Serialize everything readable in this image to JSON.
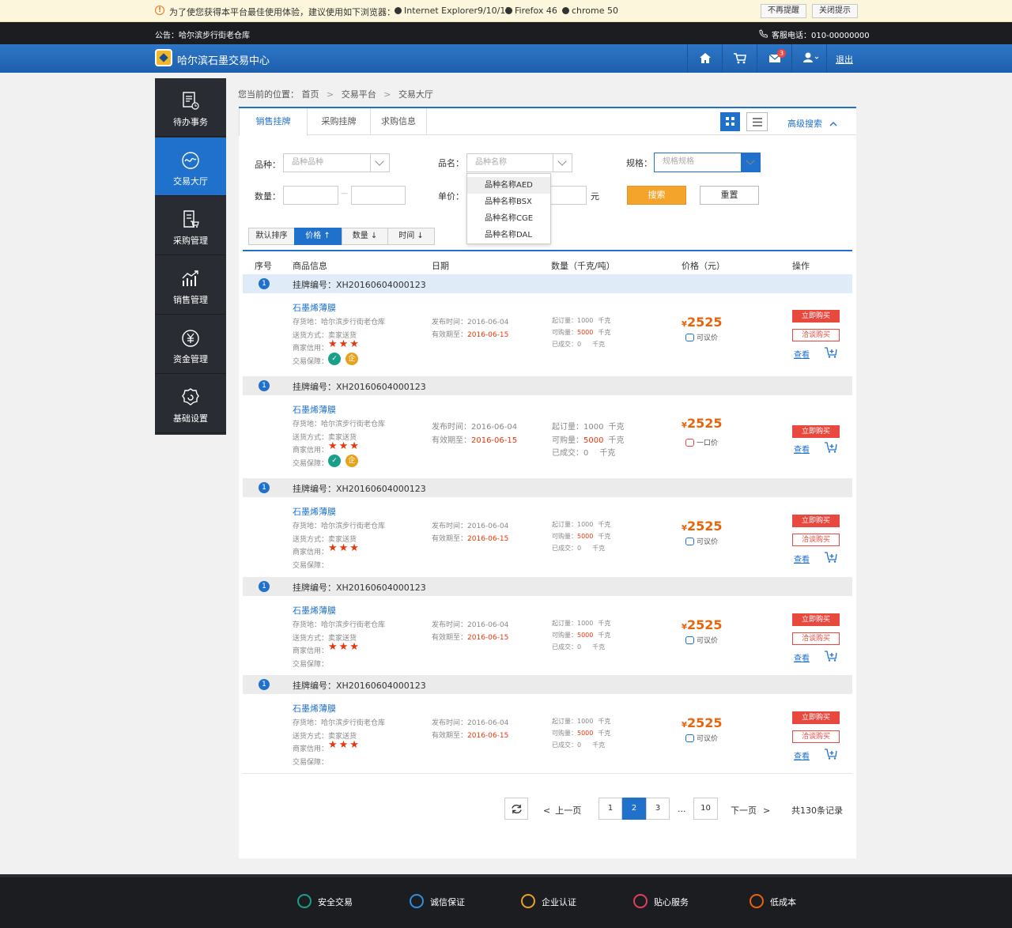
{
  "tip": {
    "message": "为了使您获得本平台最佳使用体验，建议使用如下浏览器：",
    "browsers": [
      "Internet Explorer9/10/11",
      "Firefox 46",
      "chrome 50"
    ],
    "btn_no_remind": "不再提醒",
    "btn_close": "关闭提示"
  },
  "notice": {
    "text": "公告：哈尔滨步行街老仓库",
    "hotline": "客服电话：010-00000000"
  },
  "header": {
    "site_name": "哈尔滨石墨交易中心",
    "mail_count": "3",
    "logout": "退出"
  },
  "sidebar": {
    "items": [
      {
        "label": "待办事务",
        "icon": "todo-icon"
      },
      {
        "label": "交易大厅",
        "icon": "trade-hall-icon",
        "active": true
      },
      {
        "label": "采购管理",
        "icon": "purchase-icon"
      },
      {
        "label": "销售管理",
        "icon": "sales-chart-icon"
      },
      {
        "label": "资金管理",
        "icon": "yuan-icon"
      },
      {
        "label": "基础设置",
        "icon": "gear-icon"
      }
    ]
  },
  "breadcrumb": {
    "prefix": "您当前的位置：",
    "items": [
      "首页",
      "交易平台",
      "交易大厅"
    ]
  },
  "tabs": [
    "销售挂牌",
    "采购挂牌",
    "求购信息"
  ],
  "advanced_search": "高级搜索",
  "filters": {
    "variety_label": "品种：",
    "variety_placeholder": "品种品种",
    "name_label": "品名：",
    "name_placeholder": "品种名称",
    "spec_label": "规格：",
    "spec_placeholder": "规格规格",
    "qty_label": "数量：",
    "qty_sep": "—",
    "price_label": "单价：",
    "price_unit": "元",
    "search": "搜索",
    "reset": "重置",
    "name_options": [
      "品种名称AED",
      "品种名称BSX",
      "品种名称CGE",
      "品种名称DAL"
    ]
  },
  "sort": {
    "items": [
      "默认排序",
      "价格",
      "数量",
      "时间"
    ],
    "active": "价格"
  },
  "table_headers": [
    "序号",
    "商品信息",
    "日期",
    "数量（千克/吨）",
    "价格（元）",
    "操作"
  ],
  "listings": [
    {
      "no": "1",
      "code": "挂牌编号：XH20160604000123",
      "name": "石墨烯薄膜",
      "warehouse": "存货地：哈尔滨步行街老仓库",
      "delivery": "送货方式：卖家送货",
      "credit": "商家信用：",
      "guarantee": "交易保障：",
      "publish": "发布时间：2016-06-04",
      "valid_label": "有效期至：",
      "valid": "2016-06-15",
      "min_label": "起订量：",
      "min": "1000",
      "avail_label": "可购量：",
      "avail": "5000",
      "done_label": "已成交：",
      "done": "0",
      "unit": "千克",
      "price": "2525",
      "currency": "¥",
      "price_note": "可议价",
      "buy": "立即购买",
      "talk": "洽谈购买",
      "view": "查看"
    },
    {
      "no": "1",
      "code": "挂牌编号：XH20160604000123",
      "name": "石墨烯薄膜",
      "warehouse": "存货地：哈尔滨步行街老仓库",
      "delivery": "送货方式：卖家送货",
      "credit": "商家信用：",
      "guarantee": "交易保障：",
      "publish": "发布时间：2016-06-04",
      "valid_label": "有效期至：",
      "valid": "2016-06-15",
      "min_label": "起订量：",
      "min": "1000",
      "avail_label": "可购量：",
      "avail": "5000",
      "done_label": "已成交：",
      "done": "0",
      "unit": "千克",
      "price": "2525",
      "currency": "¥",
      "price_note": "一口价",
      "buy": "立即购买",
      "talk": "",
      "view": "查看"
    },
    {
      "no": "1",
      "code": "挂牌编号：XH20160604000123",
      "name": "石墨烯薄膜",
      "warehouse": "存货地：哈尔滨步行街老仓库",
      "delivery": "送货方式：卖家送货",
      "credit": "商家信用：",
      "guarantee": "交易保障：",
      "publish": "发布时间：2016-06-04",
      "valid_label": "有效期至：",
      "valid": "2016-06-15",
      "min_label": "起订量：",
      "min": "1000",
      "avail_label": "可购量：",
      "avail": "5000",
      "done_label": "已成交：",
      "done": "0",
      "unit": "千克",
      "price": "2525",
      "currency": "¥",
      "price_note": "可议价",
      "buy": "立即购买",
      "talk": "洽谈购买",
      "view": "查看"
    },
    {
      "no": "1",
      "code": "挂牌编号：XH20160604000123",
      "name": "石墨烯薄膜",
      "warehouse": "存货地：哈尔滨步行街老仓库",
      "delivery": "送货方式：卖家送货",
      "credit": "商家信用：",
      "guarantee": "交易保障：",
      "publish": "发布时间：2016-06-04",
      "valid_label": "有效期至：",
      "valid": "2016-06-15",
      "min_label": "起订量：",
      "min": "1000",
      "avail_label": "可购量：",
      "avail": "5000",
      "done_label": "已成交：",
      "done": "0",
      "unit": "千克",
      "price": "2525",
      "currency": "¥",
      "price_note": "可议价",
      "buy": "立即购买",
      "talk": "洽谈购买",
      "view": "查看"
    },
    {
      "no": "1",
      "code": "挂牌编号：XH20160604000123",
      "name": "石墨烯薄膜",
      "warehouse": "存货地：哈尔滨步行街老仓库",
      "delivery": "送货方式：卖家送货",
      "credit": "商家信用：",
      "guarantee": "交易保障：",
      "publish": "发布时间：2016-06-04",
      "valid_label": "有效期至：",
      "valid": "2016-06-15",
      "min_label": "起订量：",
      "min": "1000",
      "avail_label": "可购量：",
      "avail": "5000",
      "done_label": "已成交：",
      "done": "0",
      "unit": "千克",
      "price": "2525",
      "currency": "¥",
      "price_note": "可议价",
      "buy": "立即购买",
      "talk": "洽谈购买",
      "view": "查看"
    }
  ],
  "pager": {
    "prev": "上一页",
    "pages": [
      "1",
      "2",
      "3"
    ],
    "ellipsis": "...",
    "last": "10",
    "current": "2",
    "next": "下一页",
    "total": "共130条记录"
  },
  "footer": {
    "items": [
      {
        "label": "安全交易",
        "color": "#1aa08a"
      },
      {
        "label": "诚信保证",
        "color": "#2e8fe0"
      },
      {
        "label": "企业认证",
        "color": "#e8a21c"
      },
      {
        "label": "贴心服务",
        "color": "#e0405a"
      },
      {
        "label": "低成本",
        "color": "#e8640b"
      }
    ]
  },
  "colors": {
    "accent": "#1f71cc",
    "price": "#e8640b",
    "buy": "#e8483e",
    "search_btn": "#f5a42b"
  }
}
